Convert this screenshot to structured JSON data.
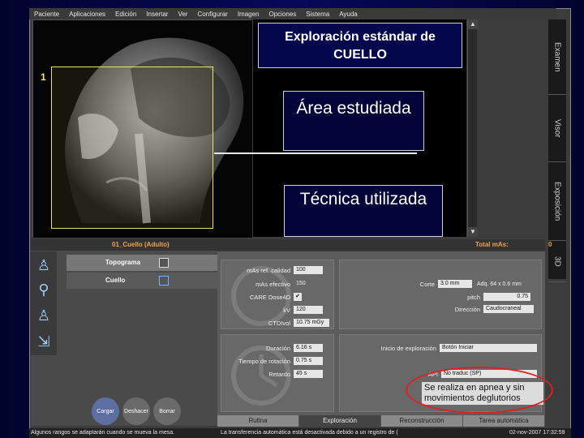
{
  "menu": [
    "Paciente",
    "Aplicaciones",
    "Edición",
    "Insertar",
    "Ver",
    "Configurar",
    "Imagen",
    "Opciones",
    "Sistema",
    "Ayuda"
  ],
  "slide": {
    "title": "Exploración estándar de CUELLO",
    "marker": "1",
    "callout_area": "Área estudiada",
    "callout_tecnica": "Técnica utilizada",
    "apnea_note": "Se realiza en apnea y sin movimientos deglutorios"
  },
  "side_tabs": [
    "Examen",
    "Visor",
    "Exposición",
    "3D"
  ],
  "scroll": {
    "up": "▲",
    "down": "▼"
  },
  "left_panel": {
    "header": "01_Cuello (Adulto)",
    "rows": [
      {
        "label": "Topograma"
      },
      {
        "label": "Cuello"
      }
    ],
    "buttons": [
      "Cargar",
      "Deshacer",
      "Borrar"
    ]
  },
  "right_panel": {
    "header_label": "Total mAs:",
    "header_value": "0",
    "dose": [
      {
        "label": "mAs ref. calidad",
        "value": "100"
      },
      {
        "label": "mAs efectivo",
        "value": "150"
      },
      {
        "label": "CARE Dose4D",
        "value": "✔"
      },
      {
        "label": "kV",
        "value": "120"
      },
      {
        "label": "CTDIvol",
        "value": "10.75 mGy"
      }
    ],
    "acq": [
      {
        "label": "Corte",
        "value": "3.0 mm",
        "extra": "Adq. 64 x 0.6 mm"
      },
      {
        "label": "pitch",
        "value": "0.75"
      },
      {
        "label": "Dirección",
        "value": "Caudocraneal"
      }
    ],
    "timing": [
      {
        "label": "Duración",
        "value": "6.16 s"
      },
      {
        "label": "Tiempo de rotación",
        "value": "0.75 s"
      },
      {
        "label": "Retardo",
        "value": "45 s"
      }
    ],
    "start_label": "Inicio de exploración",
    "start_value": "Botón Iniciar",
    "api_label": "API",
    "api_value": "No traduc (SP)"
  },
  "bottom_tabs": [
    "Rutina",
    "Exploración",
    "Reconstrucción",
    "Tarea automática"
  ],
  "status": {
    "left": "Algunos rangos se adaptarán cuando se mueva la mesa.",
    "middle": "La transferencia automática está desactivada debido a un registro de (",
    "right": "02-nov-2007 17:32:59"
  }
}
